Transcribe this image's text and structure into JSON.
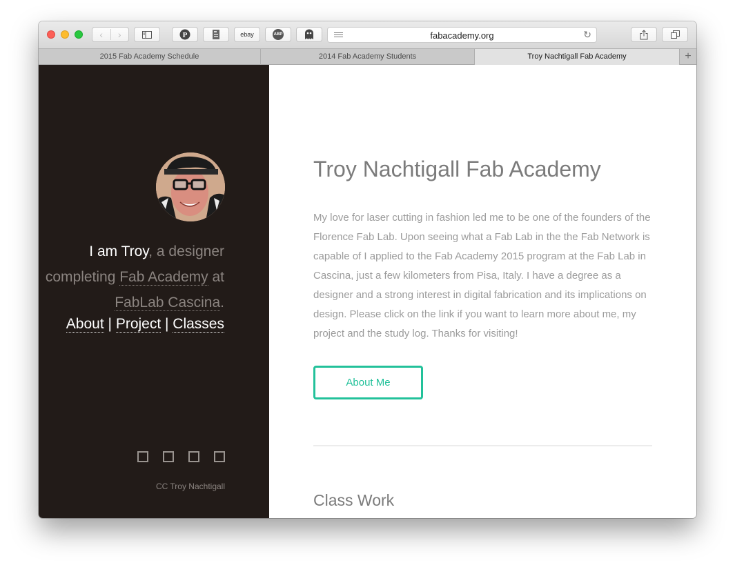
{
  "browser": {
    "url": "fabacademy.org",
    "tabs": [
      {
        "label": "2015 Fab Academy Schedule",
        "active": false
      },
      {
        "label": "2014 Fab Academy Students",
        "active": false
      },
      {
        "label": "Troy Nachtigall Fab Academy",
        "active": true
      }
    ],
    "new_tab": "+",
    "toolbar_icons": [
      "back-icon",
      "forward-icon",
      "sidebar-icon",
      "pinterest-icon",
      "reader-icon",
      "ebay-icon",
      "adblock-icon",
      "shield-icon",
      "share-icon",
      "tabs-icon"
    ],
    "ebay_label": "ebay",
    "abp_label": "ABP"
  },
  "sidebar": {
    "intro_name": "I am Troy",
    "intro_rest1": ", a designer completing ",
    "intro_link1": "Fab Academy",
    "intro_rest2": " at ",
    "intro_link2": "FabLab Cascina",
    "intro_rest3": ".",
    "nav": [
      "About",
      "Project",
      "Classes"
    ],
    "separator": " | ",
    "social_icons": [
      "social-icon-1",
      "social-icon-2",
      "social-icon-3",
      "social-icon-4"
    ],
    "copyright": "CC Troy Nachtigall"
  },
  "main": {
    "title": "Troy Nachtigall Fab Academy",
    "paragraph": "My love for laser cutting in fashion led me to be one of the founders of the Florence Fab Lab. Upon seeing what a Fab Lab in the the Fab Network is capable of I applied to the Fab Academy 2015 program at the Fab Lab in Cascina, just a few kilometers from Pisa, Italy. I have a degree as a designer and a strong interest in digital fabrication and its implications on design. Please click on the link if you want to learn more about me, my project and the study log. Thanks for visiting!",
    "button": "About Me",
    "section_title": "Class Work"
  },
  "colors": {
    "sidebar_bg": "#221b18",
    "accent": "#22c19a",
    "muted_text": "#8b8480"
  }
}
